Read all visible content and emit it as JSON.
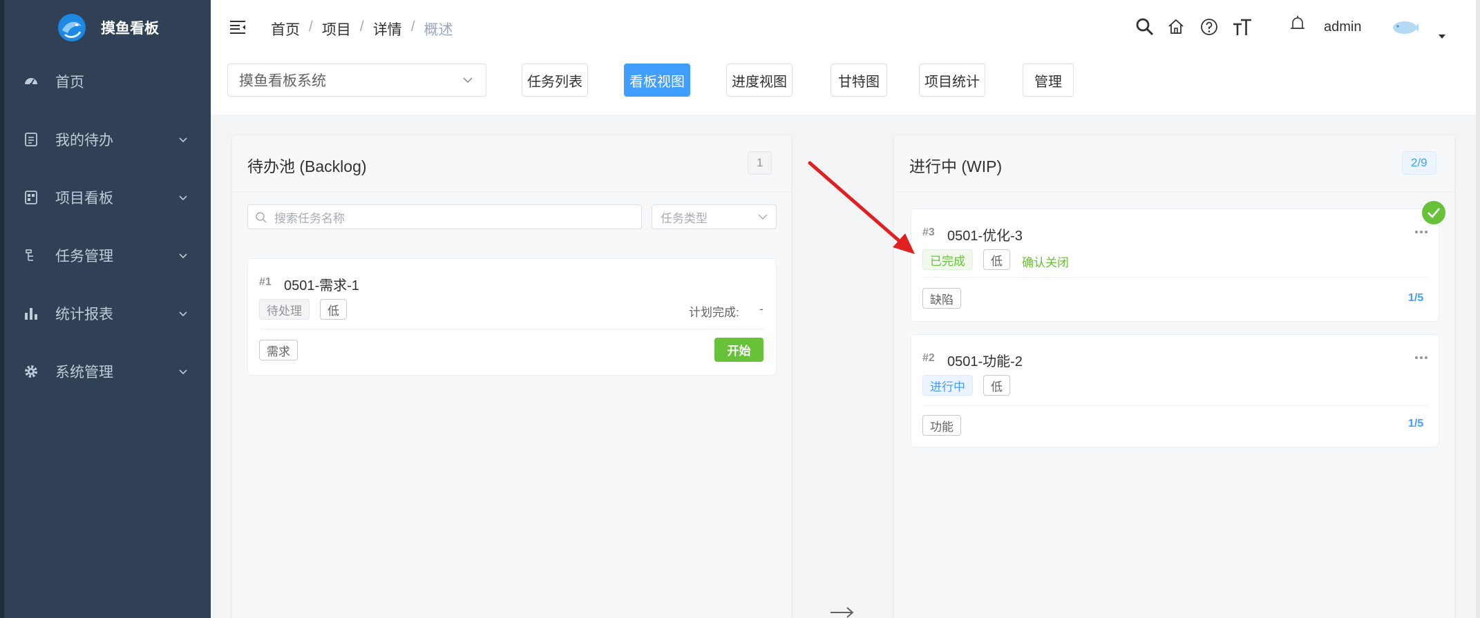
{
  "app": {
    "title": "摸鱼看板"
  },
  "sidebar": {
    "items": [
      {
        "label": "首页",
        "icon": "dashboard-icon"
      },
      {
        "label": "我的待办",
        "icon": "todo-icon"
      },
      {
        "label": "项目看板",
        "icon": "board-icon"
      },
      {
        "label": "任务管理",
        "icon": "tasks-icon"
      },
      {
        "label": "统计报表",
        "icon": "bar-chart-icon"
      },
      {
        "label": "系统管理",
        "icon": "gear-icon"
      }
    ]
  },
  "header": {
    "breadcrumb": [
      "首页",
      "项目",
      "详情",
      "概述"
    ],
    "username": "admin"
  },
  "toolbar": {
    "project": "摸鱼看板系统",
    "tabs": [
      "任务列表",
      "看板视图",
      "进度视图",
      "甘特图",
      "项目统计",
      "管理"
    ],
    "active_tab": "看板视图"
  },
  "columns": {
    "backlog": {
      "title": "待办池 (Backlog)",
      "count": "1",
      "search_placeholder": "搜索任务名称",
      "type_placeholder": "任务类型",
      "cards": [
        {
          "num": "#1",
          "name": "0501-需求-1",
          "status": "待处理",
          "priority": "低",
          "plan_label": "计划完成:",
          "plan_value": "-",
          "type": "需求",
          "action": "开始"
        }
      ]
    },
    "wip": {
      "title": "进行中 (WIP)",
      "count": "2/9",
      "cards": [
        {
          "num": "#3",
          "name": "0501-优化-3",
          "status": "已完成",
          "priority": "低",
          "link": "确认关闭",
          "type": "缺陷",
          "progress": "1/5"
        },
        {
          "num": "#2",
          "name": "0501-功能-2",
          "status": "进行中",
          "priority": "低",
          "type": "功能",
          "progress": "1/5"
        }
      ]
    }
  },
  "colors": {
    "sidebar_bg": "#304156",
    "primary": "#409eff",
    "success": "#67c23a",
    "annotation_arrow": "#e02020"
  }
}
